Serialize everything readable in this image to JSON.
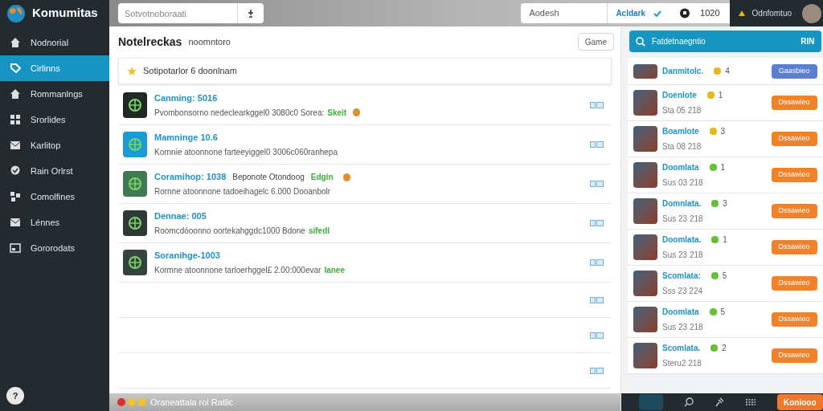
{
  "app": {
    "logo": "Komumitas"
  },
  "topbar": {
    "search_placeholder": "Sotvotnoboraati",
    "field": "Aodesh",
    "link": "Acldark",
    "count": "1020",
    "user": "Odnfomtuo"
  },
  "sidebar": {
    "items": [
      {
        "label": "Nodnorial",
        "selected": false
      },
      {
        "label": "Cirlinns",
        "selected": true
      },
      {
        "label": "Rommanlngs",
        "selected": false
      },
      {
        "label": "Srorlides",
        "selected": false
      },
      {
        "label": "Karlitop",
        "selected": false
      },
      {
        "label": "Rain Orlrst",
        "selected": false
      },
      {
        "label": "Comolfines",
        "selected": false
      },
      {
        "label": "Lénnes",
        "selected": false
      },
      {
        "label": "Gororodats",
        "selected": false
      }
    ],
    "help": "?"
  },
  "main": {
    "title": "Notelreckas",
    "subtitle": "noomntoro",
    "button": "Game",
    "pinned": "Sotipotarlor 6 doonlnam",
    "feed": [
      {
        "title": "Canming: 5016",
        "text": "Pvombonsorno nedeclearkggel0 3080c0 Sorea:",
        "tag": "Skeit",
        "emoji": true,
        "color": "#1f2a24"
      },
      {
        "title": "Mamninge 10.6",
        "text": "Kornnie atoonnone farteeyiggel0 3006c060ranhepa",
        "emoji": false,
        "color": "#1c9ad6"
      },
      {
        "title": "Coramihop: 1038",
        "note": "Beponote Otondoog",
        "tag": "Edgin",
        "text": "Rornne atoonnone tadoeihagelc 6.000 Dooanbolr",
        "emoji": true,
        "color": "#3f7a52"
      },
      {
        "title": "Dennae: 005",
        "text": "Roomcdóoonno oortekahggdc1000 Bdone",
        "tag": "sifedl",
        "emoji": false,
        "color": "#2f3a34"
      },
      {
        "title": "Soranihge-1003",
        "text": "Kormne atoonnone tarloerhggel£ 2.00:000evar",
        "tag": "lanee",
        "emoji": false,
        "color": "#34443c"
      },
      {
        "kind": "empty"
      },
      {
        "kind": "empty"
      },
      {
        "kind": "empty"
      }
    ],
    "status": "Oraneattala rol Ratlic"
  },
  "panel": {
    "search": "Fatdetnaegntio",
    "search_tag": "RIN",
    "items": [
      {
        "name": "Danmitolc.",
        "score": "4",
        "color": "#e6b820",
        "button": "Gaasbieo",
        "kind": "primary"
      },
      {
        "name": "Doenlote",
        "score": "1",
        "color": "#e6b820",
        "meta": "Sta 05 218",
        "button": "Dssawieo",
        "kind": "warn"
      },
      {
        "name": "Boamlote",
        "score": "3",
        "color": "#e6b820",
        "meta": "Sta 08 218",
        "button": "Dssawieo",
        "kind": "warn"
      },
      {
        "name": "Doomlata",
        "score": "1",
        "color": "#6abf3a",
        "meta": "Sus 03 218",
        "button": "Dssawieo",
        "kind": "warn"
      },
      {
        "name": "Domnlata.",
        "score": "3",
        "color": "#6abf3a",
        "meta": "Sus 23 218",
        "button": "Dssawieo",
        "kind": "warn"
      },
      {
        "name": "Doomlata.",
        "score": "1",
        "color": "#6abf3a",
        "meta": "Sus 23 218",
        "button": "Dssawieo",
        "kind": "warn"
      },
      {
        "name": "Scomlata:",
        "score": "5",
        "color": "#6abf3a",
        "meta": "Sss 23 224",
        "button": "Dssawieo",
        "kind": "warn"
      },
      {
        "name": "Doomlata",
        "score": "5",
        "color": "#6abf3a",
        "meta": "Sus 23 218",
        "button": "Dssawieo",
        "kind": "warn"
      },
      {
        "name": "Scomlata.",
        "score": "2",
        "color": "#6abf3a",
        "meta": "Steru2 218",
        "button": "Dssawieo",
        "kind": "warn"
      }
    ],
    "bottom_button": "Koniooo"
  }
}
